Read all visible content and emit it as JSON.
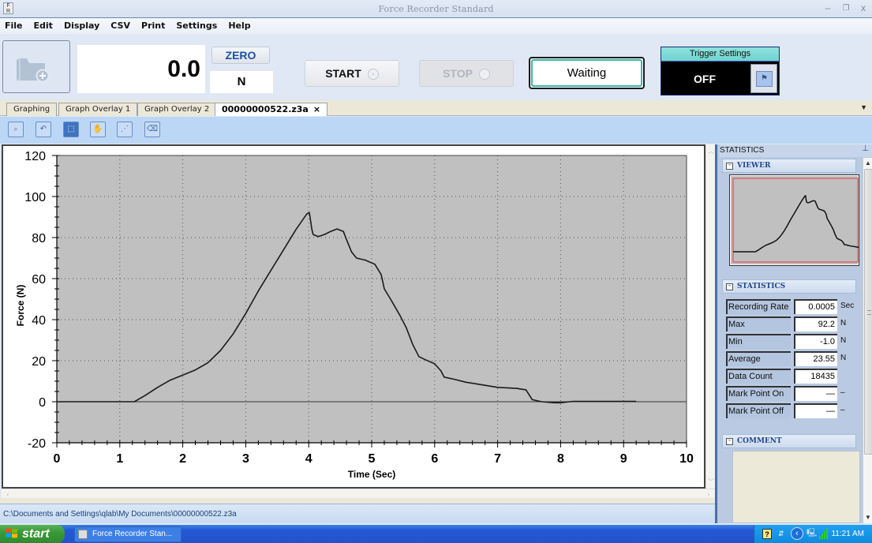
{
  "window": {
    "title": "Force Recorder Standard",
    "controls": {
      "minimize": "–",
      "restore": "❐",
      "close": "x"
    }
  },
  "menu": [
    "File",
    "Edit",
    "Display",
    "CSV",
    "Print",
    "Settings",
    "Help"
  ],
  "toolbar": {
    "open_icon": "folder-add-icon",
    "reading_value": "0.0",
    "zero_label": "ZERO",
    "unit": "N",
    "start_label": "START",
    "stop_label": "STOP",
    "status": "Waiting",
    "trigger": {
      "title": "Trigger Settings",
      "state": "OFF",
      "icon": "flag-icon"
    }
  },
  "tabs": [
    {
      "label": "Graphing",
      "active": false
    },
    {
      "label": "Graph Overlay 1",
      "active": false
    },
    {
      "label": "Graph Overlay 2",
      "active": false
    },
    {
      "label": "00000000522.z3a",
      "active": true,
      "close": "×"
    }
  ],
  "graph_tools": [
    {
      "name": "zoom-100-icon",
      "glyph": "🔍"
    },
    {
      "name": "undo-zoom-icon",
      "glyph": "↶"
    },
    {
      "name": "box-zoom-icon",
      "glyph": "⬚",
      "selected": true
    },
    {
      "name": "pan-hand-icon",
      "glyph": "✋"
    },
    {
      "name": "mark-points-icon",
      "glyph": "⋰"
    },
    {
      "name": "clear-marks-icon",
      "glyph": "⌫"
    }
  ],
  "chart_data": {
    "type": "line",
    "title": "",
    "xlabel": "Time (Sec)",
    "ylabel": "Force (N)",
    "xlim": [
      0,
      10
    ],
    "ylim": [
      -20,
      120
    ],
    "x_ticks": [
      0,
      1,
      2,
      3,
      4,
      5,
      6,
      7,
      8,
      9,
      10
    ],
    "y_ticks": [
      -20,
      0,
      20,
      40,
      60,
      80,
      100,
      120
    ],
    "grid": true,
    "background": "#c0c0c0",
    "line_color": "#1a1a1a",
    "series": [
      {
        "name": "Force",
        "x": [
          0,
          1.23,
          1.4,
          1.6,
          1.8,
          2.0,
          2.2,
          2.4,
          2.6,
          2.8,
          3.0,
          3.2,
          3.4,
          3.6,
          3.8,
          3.97,
          4.01,
          4.05,
          4.07,
          4.15,
          4.25,
          4.35,
          4.45,
          4.55,
          4.6,
          4.68,
          4.76,
          4.9,
          5.05,
          5.15,
          5.2,
          5.3,
          5.45,
          5.55,
          5.65,
          5.75,
          5.85,
          6.0,
          6.1,
          6.15,
          6.3,
          6.5,
          6.8,
          7.0,
          7.3,
          7.45,
          7.55,
          7.7,
          7.9,
          8.0,
          8.2,
          9.2
        ],
        "y": [
          0,
          0,
          3,
          7,
          10.5,
          13,
          15.5,
          19,
          25,
          33,
          43,
          54,
          64,
          74,
          84,
          91.5,
          92.2,
          84,
          81.5,
          80.5,
          81.5,
          83,
          84.2,
          83,
          79,
          73,
          70,
          69,
          67,
          62,
          55,
          50,
          42,
          36,
          28,
          22,
          20.5,
          18.5,
          15,
          12,
          11,
          9.5,
          8,
          7,
          6.5,
          5.8,
          1,
          0,
          -0.5,
          -0.5,
          0.2,
          0.2
        ]
      }
    ]
  },
  "right_panel": {
    "header": "STATISTICS",
    "viewer_label": "VIEWER",
    "statistics_label": "STATISTICS",
    "comment_label": "COMMENT",
    "stats": [
      {
        "label": "Recording Rate",
        "value": "0.0005",
        "unit": "Sec"
      },
      {
        "label": "Max",
        "value": "92.2",
        "unit": "N"
      },
      {
        "label": "Min",
        "value": "-1.0",
        "unit": "N"
      },
      {
        "label": "Average",
        "value": "23.55",
        "unit": "N"
      },
      {
        "label": "Data Count",
        "value": "18435",
        "unit": ""
      },
      {
        "label": "Mark Point On",
        "value": "—",
        "unit": "–"
      },
      {
        "label": "Mark Point Off",
        "value": "—",
        "unit": "–"
      }
    ],
    "comment": ""
  },
  "status_path": "C:\\Documents and Settings\\qlab\\My Documents\\00000000522.z3a",
  "taskbar": {
    "start_label": "start",
    "task_item": "Force Recorder Stan...",
    "clock": "11:21 AM"
  }
}
